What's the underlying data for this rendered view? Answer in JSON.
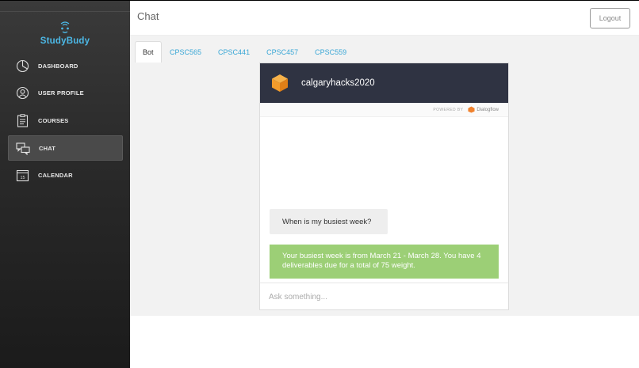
{
  "app": {
    "name": "StudyBudy"
  },
  "nav": {
    "items": [
      {
        "label": "DASHBOARD",
        "icon": "pie-chart-icon"
      },
      {
        "label": "USER PROFILE",
        "icon": "user-icon"
      },
      {
        "label": "COURSES",
        "icon": "clipboard-icon"
      },
      {
        "label": "CHAT",
        "icon": "chat-bubbles-icon",
        "active": true
      },
      {
        "label": "CALENDAR",
        "icon": "calendar-icon",
        "badge": "15"
      }
    ]
  },
  "header": {
    "title": "Chat",
    "logout_label": "Logout"
  },
  "tabs": [
    {
      "label": "Bot",
      "active": true
    },
    {
      "label": "CPSC565"
    },
    {
      "label": "CPSC441"
    },
    {
      "label": "CPSC457"
    },
    {
      "label": "CPSC559"
    }
  ],
  "chat": {
    "agent_name": "calgaryhacks2020",
    "powered_by": "POWERED BY",
    "provider": "Dialogflow",
    "messages": [
      {
        "from": "user",
        "text": "When is my busiest week?"
      },
      {
        "from": "bot",
        "text": "Your busiest week is from March 21 - March 28. You have 4 deliverables due for a total of 75 weight."
      }
    ],
    "input_placeholder": "Ask something..."
  },
  "colors": {
    "brand": "#4cb8e6",
    "tab_link": "#3aa7d6",
    "chat_header": "#2f3342",
    "bot_bubble": "#9ccf76",
    "agent_orange": "#f39c2c"
  }
}
